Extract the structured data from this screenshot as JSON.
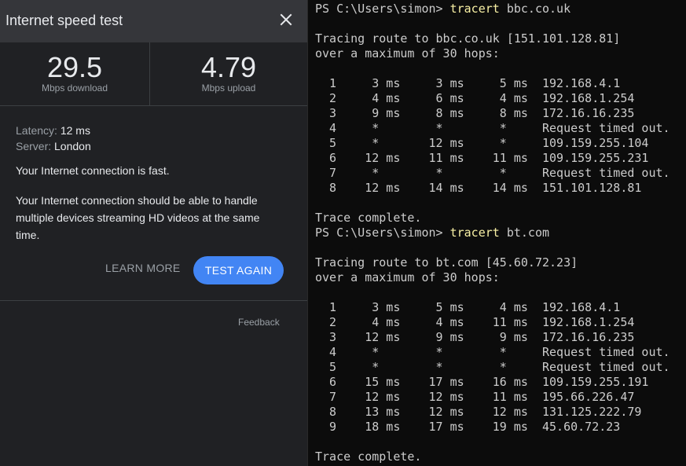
{
  "speed_test": {
    "title": "Internet speed test",
    "close_icon": "close-icon",
    "download": {
      "value": "29.5",
      "unit": "Mbps download"
    },
    "upload": {
      "value": "4.79",
      "unit": "Mbps upload"
    },
    "latency": {
      "label": "Latency:",
      "value": "12 ms"
    },
    "server": {
      "label": "Server:",
      "value": "London"
    },
    "status": "Your Internet connection is fast.",
    "description": "Your Internet connection should be able to handle multiple devices streaming HD videos at the same time.",
    "learn_more": "LEARN MORE",
    "test_again": "TEST AGAIN",
    "feedback": "Feedback",
    "colors": {
      "accent": "#4285f4",
      "panel": "#202124",
      "header": "#35363a"
    }
  },
  "terminal": {
    "colors": {
      "background": "#0c0c0c",
      "text": "#cccccc",
      "command": "#f9f1a5"
    },
    "lines": [
      {
        "prompt": "PS C:\\Users\\simon> ",
        "command": "tracert",
        "args": " bbc.co.uk"
      },
      {
        "text": ""
      },
      {
        "text": "Tracing route to bbc.co.uk [151.101.128.81]"
      },
      {
        "text": "over a maximum of 30 hops:"
      },
      {
        "text": ""
      },
      {
        "text": "  1     3 ms     3 ms     5 ms  192.168.4.1"
      },
      {
        "text": "  2     4 ms     6 ms     4 ms  192.168.1.254"
      },
      {
        "text": "  3     9 ms     8 ms     8 ms  172.16.16.235"
      },
      {
        "text": "  4     *        *        *     Request timed out."
      },
      {
        "text": "  5     *       12 ms     *     109.159.255.104"
      },
      {
        "text": "  6    12 ms    11 ms    11 ms  109.159.255.231"
      },
      {
        "text": "  7     *        *        *     Request timed out."
      },
      {
        "text": "  8    12 ms    14 ms    14 ms  151.101.128.81"
      },
      {
        "text": ""
      },
      {
        "text": "Trace complete."
      },
      {
        "prompt": "PS C:\\Users\\simon> ",
        "command": "tracert",
        "args": " bt.com"
      },
      {
        "text": ""
      },
      {
        "text": "Tracing route to bt.com [45.60.72.23]"
      },
      {
        "text": "over a maximum of 30 hops:"
      },
      {
        "text": ""
      },
      {
        "text": "  1     3 ms     5 ms     4 ms  192.168.4.1"
      },
      {
        "text": "  2     4 ms     4 ms    11 ms  192.168.1.254"
      },
      {
        "text": "  3    12 ms     9 ms     9 ms  172.16.16.235"
      },
      {
        "text": "  4     *        *        *     Request timed out."
      },
      {
        "text": "  5     *        *        *     Request timed out."
      },
      {
        "text": "  6    15 ms    17 ms    16 ms  109.159.255.191"
      },
      {
        "text": "  7    12 ms    12 ms    11 ms  195.66.226.47"
      },
      {
        "text": "  8    13 ms    12 ms    12 ms  131.125.222.79"
      },
      {
        "text": "  9    18 ms    17 ms    19 ms  45.60.72.23"
      },
      {
        "text": ""
      },
      {
        "text": "Trace complete."
      }
    ]
  }
}
